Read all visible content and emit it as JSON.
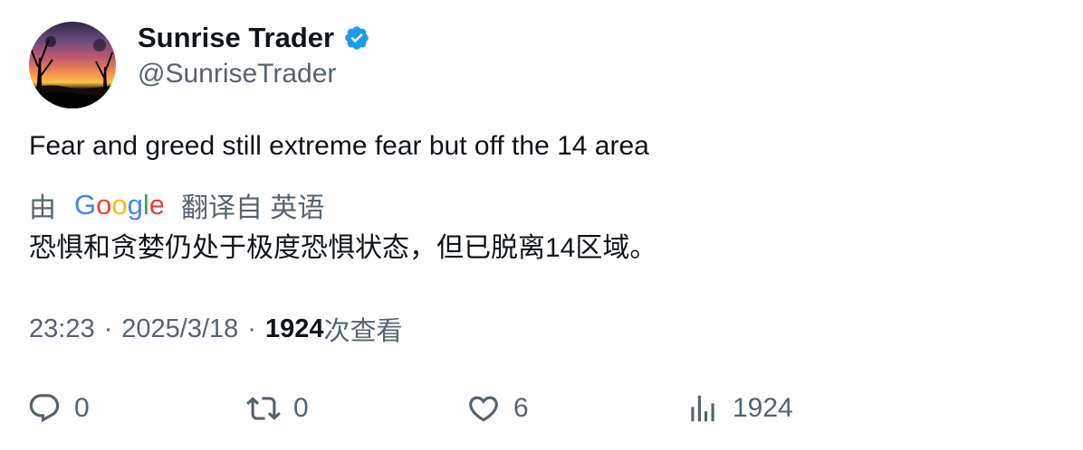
{
  "author": {
    "display_name": "Sunrise Trader",
    "handle": "@SunriseTrader",
    "verified": true,
    "verified_icon": "verified-badge-icon",
    "avatar": "sunset-landscape-avatar"
  },
  "tweet": {
    "text": "Fear and greed still extreme fear but off the 14 area"
  },
  "translation": {
    "prefix": "由",
    "provider": "Google",
    "suffix": "翻译自 英语",
    "text": "恐惧和贪婪仍处于极度恐惧状态，但已脱离14区域。"
  },
  "meta": {
    "time": "23:23",
    "separator": "·",
    "date": "2025/3/18",
    "views": "1924",
    "views_label": "次查看"
  },
  "actions": {
    "reply": {
      "icon": "reply-icon",
      "count": "0"
    },
    "repost": {
      "icon": "repost-icon",
      "count": "0"
    },
    "like": {
      "icon": "heart-icon",
      "count": "6"
    },
    "views": {
      "icon": "analytics-icon",
      "count": "1924"
    }
  },
  "colors": {
    "text": "#0f1419",
    "secondary": "#536471",
    "verified_blue": "#1d9bf0"
  }
}
